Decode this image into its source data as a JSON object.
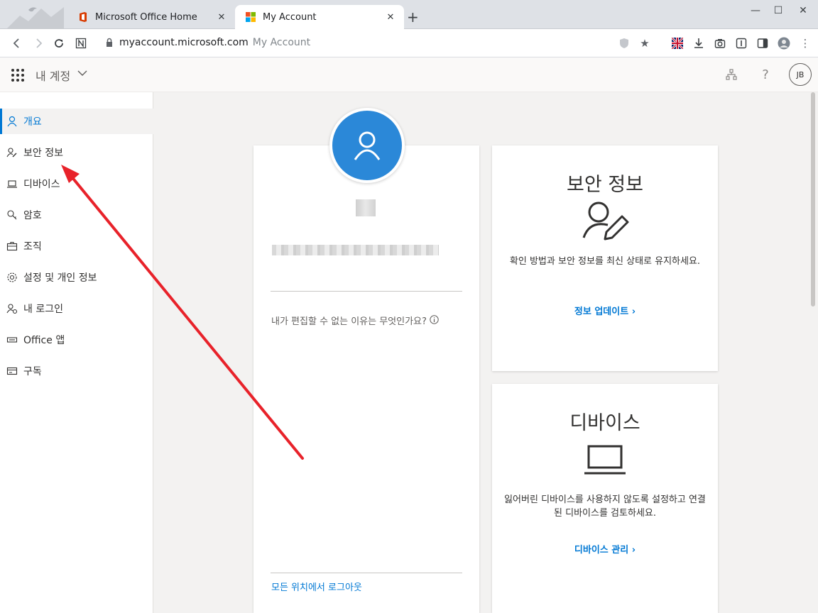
{
  "browser": {
    "tabs": [
      {
        "title": "Microsoft Office Home",
        "icon": "office-icon"
      },
      {
        "title": "My Account",
        "icon": "microsoft-icon"
      }
    ],
    "new_tab": "+",
    "address": {
      "url": "myaccount.microsoft.com",
      "page_title": "My Account"
    }
  },
  "header": {
    "title": "내 계정",
    "avatar_initials": "JB"
  },
  "sidebar": {
    "items": [
      {
        "label": "개요",
        "icon": "person-icon",
        "selected": true
      },
      {
        "label": "보안 정보",
        "icon": "person-key-icon"
      },
      {
        "label": "디바이스",
        "icon": "laptop-icon"
      },
      {
        "label": "암호",
        "icon": "key-icon"
      },
      {
        "label": "조직",
        "icon": "briefcase-icon"
      },
      {
        "label": "설정 및 개인 정보",
        "icon": "gear-icon"
      },
      {
        "label": "내 로그인",
        "icon": "person-signin-icon"
      },
      {
        "label": "Office 앱",
        "icon": "office-apps-icon"
      },
      {
        "label": "구독",
        "icon": "card-icon"
      }
    ]
  },
  "profile": {
    "why_cant_edit": "내가 편집할 수 없는 이유는 무엇인가요?",
    "sign_out_everywhere": "모든 위치에서 로그아웃"
  },
  "security_card": {
    "title": "보안 정보",
    "description": "확인 방법과 보안 정보를 최신 상태로 유지하세요.",
    "link": "정보 업데이트 ›"
  },
  "devices_card": {
    "title": "디바이스",
    "description": "잃어버린 디바이스를 사용하지 않도록 설정하고 연결된 디바이스를 검토하세요.",
    "link": "디바이스 관리 ›"
  },
  "colors": {
    "accent": "#0078d4",
    "avatar": "#2b88d8",
    "annotation_arrow": "#e8222a"
  }
}
